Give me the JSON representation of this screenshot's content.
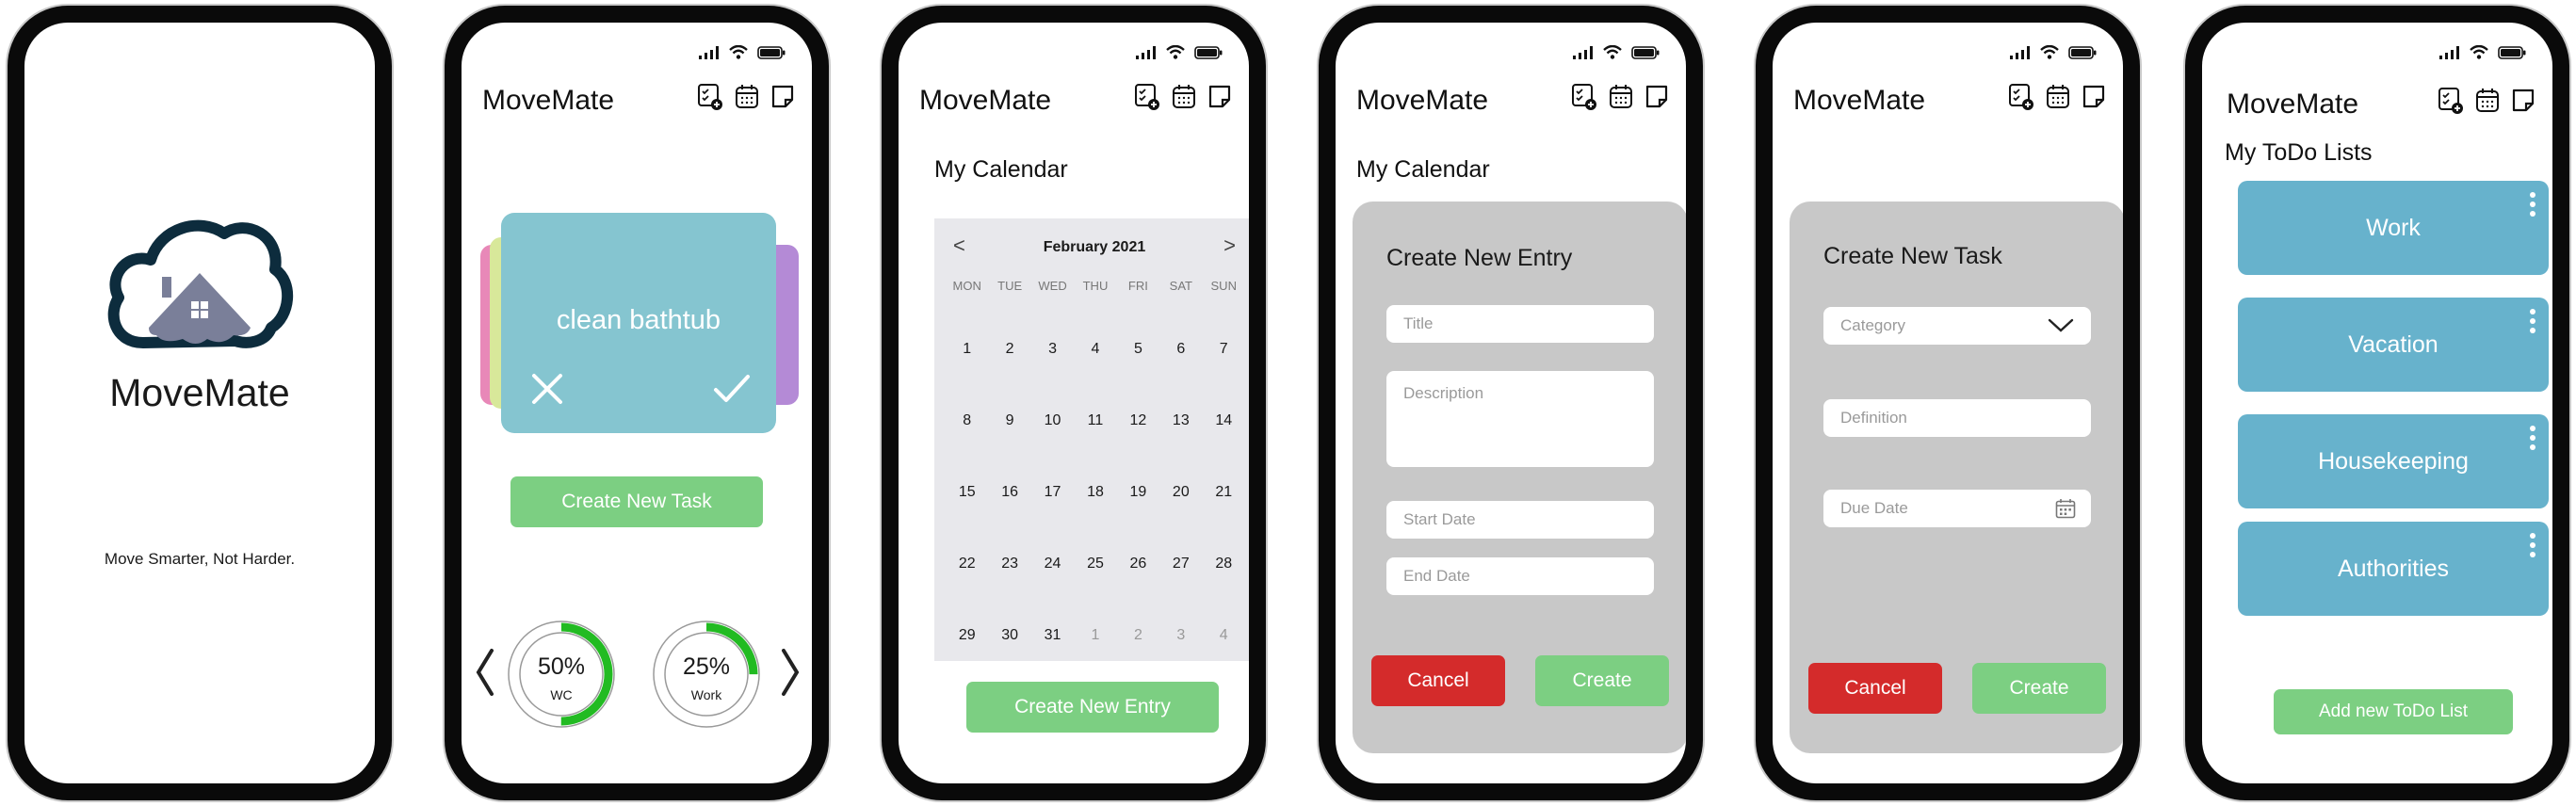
{
  "app_name": "MoveMate",
  "splash": {
    "title": "MoveMate",
    "tagline": "Move Smarter, Not Harder."
  },
  "home": {
    "card_text": "clean bathtub",
    "create_task_label": "Create New Task",
    "progress": [
      {
        "percent_label": "50%",
        "category": "WC",
        "value": 0.5
      },
      {
        "percent_label": "25%",
        "category": "Work",
        "value": 0.25
      }
    ]
  },
  "calendar": {
    "heading": "My Calendar",
    "month_label": "February 2021",
    "prev_label": "<",
    "next_label": ">",
    "weekdays": [
      "MON",
      "TUE",
      "WED",
      "THU",
      "FRI",
      "SAT",
      "SUN"
    ],
    "weeks": [
      [
        "1",
        "2",
        "3",
        "4",
        "5",
        "6",
        "7"
      ],
      [
        "8",
        "9",
        "10",
        "11",
        "12",
        "13",
        "14"
      ],
      [
        "15",
        "16",
        "17",
        "18",
        "19",
        "20",
        "21"
      ],
      [
        "22",
        "23",
        "24",
        "25",
        "26",
        "27",
        "28"
      ],
      [
        "29",
        "30",
        "31",
        "1",
        "2",
        "3",
        "4"
      ]
    ],
    "create_entry_label": "Create New Entry"
  },
  "new_entry": {
    "heading": "My Calendar",
    "panel_title": "Create New Entry",
    "title_placeholder": "Title",
    "description_placeholder": "Description",
    "start_date_placeholder": "Start Date",
    "end_date_placeholder": "End Date",
    "cancel_label": "Cancel",
    "create_label": "Create"
  },
  "new_task": {
    "panel_title": "Create New Task",
    "category_placeholder": "Category",
    "definition_placeholder": "Definition",
    "due_date_placeholder": "Due Date",
    "cancel_label": "Cancel",
    "create_label": "Create"
  },
  "todo": {
    "heading": "My ToDo Lists",
    "lists": [
      "Work",
      "Vacation",
      "Housekeeping",
      "Authorities"
    ],
    "add_label": "Add new ToDo List"
  },
  "colors": {
    "green": "#7ccf82",
    "red": "#d42b2b",
    "card_blue": "#85c5d0",
    "todo_blue": "#67b2cc",
    "panel_gray": "#c8c8c8",
    "progress_green": "#22bb22"
  }
}
